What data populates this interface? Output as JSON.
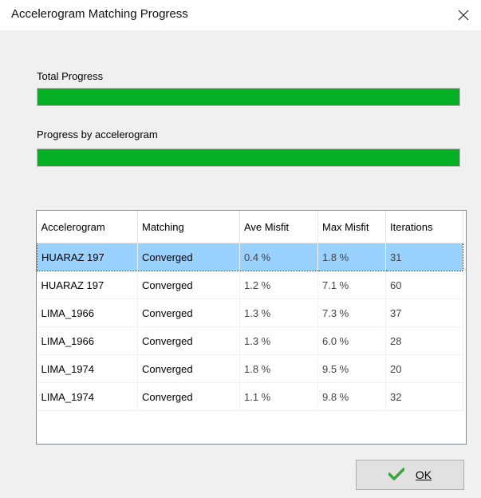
{
  "window": {
    "title": "Accelerogram Matching Progress"
  },
  "total_progress": {
    "label": "Total Progress",
    "value": 1.0
  },
  "accelerogram_progress": {
    "label": "Progress by accelerogram",
    "value": 1.0
  },
  "colors": {
    "progress_fill": "#06b025",
    "selection": "#99d1ff",
    "ok_check": "#3aa53a"
  },
  "table": {
    "columns": [
      "Accelerogram",
      "Matching",
      "Ave Misfit",
      "Max Misfit",
      "Iterations"
    ],
    "rows": [
      [
        "HUARAZ 197",
        "Converged",
        "0.4 %",
        "1.8 %",
        "31"
      ],
      [
        "HUARAZ 197",
        "Converged",
        "1.2 %",
        "7.1 %",
        "60"
      ],
      [
        "LIMA_1966",
        "Converged",
        "1.3 %",
        "7.3 %",
        "37"
      ],
      [
        "LIMA_1966",
        "Converged",
        "1.3 %",
        "6.0 %",
        "28"
      ],
      [
        "LIMA_1974",
        "Converged",
        "1.8 %",
        "9.5 %",
        "20"
      ],
      [
        "LIMA_1974",
        "Converged",
        "1.1 %",
        "9.8 %",
        "32"
      ]
    ],
    "selected_row": 0
  },
  "ok_button": {
    "label": "OK",
    "icon": "checkmark-icon"
  }
}
